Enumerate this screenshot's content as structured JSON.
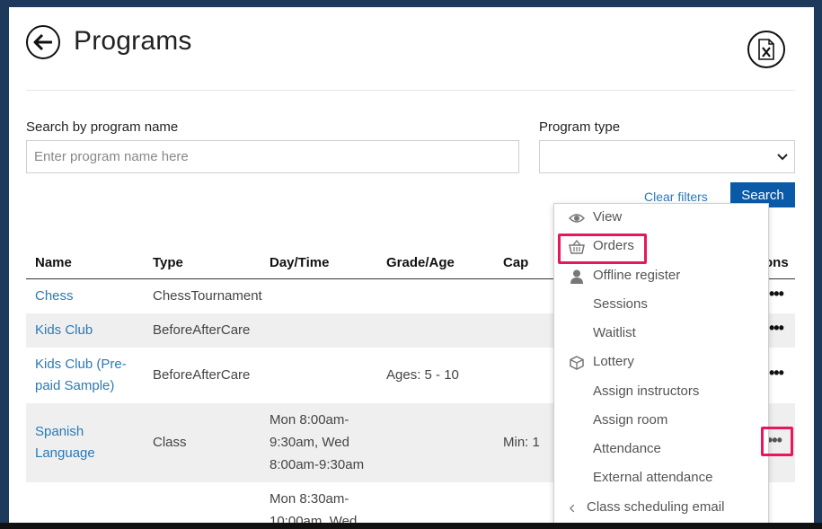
{
  "header": {
    "title": "Programs"
  },
  "filters": {
    "search_label": "Search by program name",
    "search_placeholder": "Enter program name here",
    "search_value": "",
    "type_label": "Program type",
    "type_selected": "",
    "clear_label": "Clear filters",
    "search_button": "Search"
  },
  "table": {
    "headers": [
      "Name",
      "Type",
      "Day/Time",
      "Grade/Age",
      "Cap",
      "ons"
    ],
    "rows": [
      {
        "name": "Chess",
        "type": "ChessTournament",
        "daytime": "",
        "grade": "",
        "cap": ""
      },
      {
        "name": "Kids Club",
        "type": "BeforeAfterCare",
        "daytime": "",
        "grade": "",
        "cap": ""
      },
      {
        "name": "Kids Club (Pre-paid Sample)",
        "type": "BeforeAfterCare",
        "daytime": "",
        "grade": "Ages: 5 - 10",
        "cap": ""
      },
      {
        "name": "Spanish Language",
        "type": "Class",
        "daytime": "Mon 8:00am-9:30am, Wed 8:00am-9:30am",
        "grade": "",
        "cap": "Min: 1"
      },
      {
        "name": "",
        "type": "",
        "daytime": "Mon 8:30am-10:00am, Wed",
        "grade": "",
        "cap": ""
      }
    ],
    "actions_glyph": "•••"
  },
  "menu": {
    "items": [
      {
        "label": "View",
        "icon": "eye-icon"
      },
      {
        "label": "Orders",
        "icon": "basket-icon"
      },
      {
        "label": "Offline register",
        "icon": "person-icon"
      },
      {
        "label": "Sessions",
        "icon": ""
      },
      {
        "label": "Waitlist",
        "icon": ""
      },
      {
        "label": "Lottery",
        "icon": "cube-icon"
      },
      {
        "label": "Assign instructors",
        "icon": ""
      },
      {
        "label": "Assign room",
        "icon": ""
      },
      {
        "label": "Attendance",
        "icon": ""
      },
      {
        "label": "External attendance",
        "icon": ""
      },
      {
        "label": "Class scheduling email",
        "icon": "chevron-left-icon"
      }
    ]
  },
  "colors": {
    "link": "#2a7ab8",
    "primary": "#0b5aa8",
    "highlight": "#e8175d"
  }
}
